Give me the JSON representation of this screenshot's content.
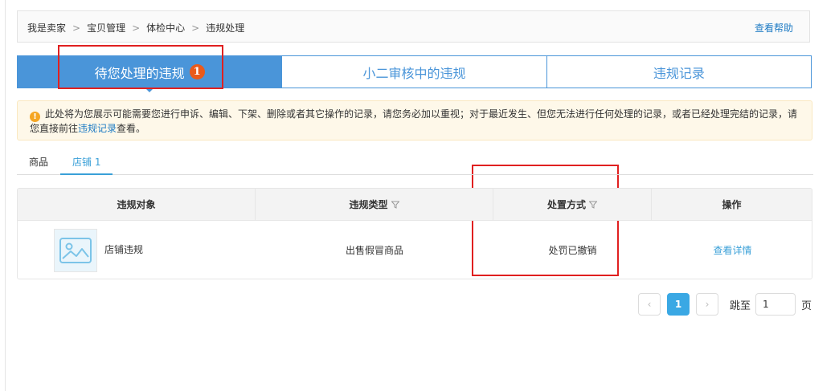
{
  "breadcrumb": [
    "我是卖家",
    "宝贝管理",
    "体检中心",
    "违规处理"
  ],
  "breadcrumb_separator": ">",
  "help_link": "查看帮助",
  "main_tabs": [
    {
      "label": "待您处理的违规",
      "badge": "1",
      "active": true
    },
    {
      "label": "小二审核中的违规"
    },
    {
      "label": "违规记录"
    }
  ],
  "notice": {
    "icon": "!",
    "text_before": "此处将为您展示可能需要您进行申诉、编辑、下架、删除或者其它操作的记录，请您务必加以重视；对于最近发生、但您无法进行任何处理的记录，或者已经处理完结的记录，请您直接前往",
    "link": "违规记录",
    "text_after": "查看。"
  },
  "sub_tabs": [
    {
      "label": "商品"
    },
    {
      "label": "店铺 1",
      "active": true
    }
  ],
  "table": {
    "headers": [
      "违规对象",
      "违规类型",
      "处置方式",
      "操作"
    ],
    "rows": [
      {
        "object": "店铺违规",
        "type": "出售假冒商品",
        "action": "处罚已撤销",
        "operation": "查看详情"
      }
    ]
  },
  "pagination": {
    "prev": "‹",
    "current": "1",
    "next": "›",
    "jump_label": "跳至",
    "jump_value": "1",
    "page_unit": "页"
  },
  "colors": {
    "accent": "#4a95d9",
    "badge": "#ea5a1a",
    "link": "#3aa0d8",
    "highlight_box": "#e02020"
  }
}
